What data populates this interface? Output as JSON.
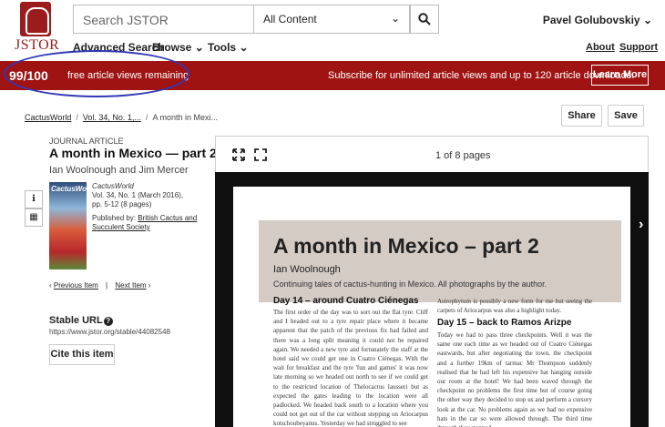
{
  "header": {
    "logo_text": "JSTOR",
    "search_placeholder": "Search JSTOR",
    "content_filter": "All Content",
    "user_name": "Pavel Golubovskiy",
    "nav": [
      "Advanced Search",
      "Browse",
      "Tools"
    ],
    "links": [
      "About",
      "Support"
    ]
  },
  "banner": {
    "count": "99/100",
    "remaining_text": "free article views remaining",
    "subscribe_text": "Subscribe for unlimited article views and up to 120 article downloads.",
    "learn_more": "Learn More",
    "color": "#9f1313",
    "annotation_color": "#3138b6"
  },
  "breadcrumb": [
    "CactusWorld",
    "Vol. 34, No. 1,...",
    "A month in Mexi..."
  ],
  "actions": {
    "share": "Share",
    "save": "Save"
  },
  "article": {
    "type": "JOURNAL ARTICLE",
    "title": "A month in Mexico — part 2",
    "authors": "Ian Woolnough and Jim Mercer",
    "cover_title": "CactusWorld",
    "journal": "CactusWorld",
    "volume": "Vol. 34, No. 1 (March 2016),",
    "pages": "pp. 5-12 (8 pages)",
    "published_by_label": "Published by:",
    "publisher": "British Cactus and Succulent Society",
    "prev_item": "Previous Item",
    "next_item": "Next Item",
    "stable_url_label": "Stable URL",
    "stable_url": "https://www.jstor.org/stable/44082548",
    "cite": "Cite this item"
  },
  "viewer": {
    "page_count": "1 of 8 pages",
    "doc_title": "A month in Mexico – part 2",
    "doc_author": "Ian Woolnough",
    "doc_subtitle": "Continuing tales of cactus-hunting in Mexico. All photographs by the author.",
    "section1_head": "Day 14 – around Cuatro Ciénegas",
    "section1_text": "The first order of the day was to sort out the flat tyre. Cliff and I headed out to a tyre repair place where it became apparent that the patch of the previous fix had failed and there was a long split meaning it could not be repaired again. We needed a new tyre and fortunately the staff at the hotel said we could get one in Cuatro Ciénegas. With the wait for breakfast and the tyre 'fun and games' it was now late morning so we headed out north to see if we could get to the restricted location of Thelocactus lausseri but as expected the gates leading to the location were all padlocked. We headed back south to a location where you could not get out of the car without stepping on Ariocarpus kotschoubeyanus. Yesterday we had struggled to see",
    "col2_intro": "Astrophytum is possibly a new form for me but seeing the carpets of Ariocarpus was also a highlight today.",
    "section2_head": "Day 15 – back to Ramos Arizpe",
    "section2_text": "Today we had to pass three checkpoints. Well it was the same one each time as we headed out of Cuatro Ciénegas eastwards, but after negotiating the town, the checkpoint and a further 19km of tarmac Mr Thompson suddenly realised that he had left his expensive hat hanging outside our room at the hotel! We had been waved through the checkpoint no problems the first time but of course going the other way they decided to stop us and perform a cursory look at the car. No problems again as we had no expensive hats in the car so were allowed through. The third time through they stopped"
  }
}
